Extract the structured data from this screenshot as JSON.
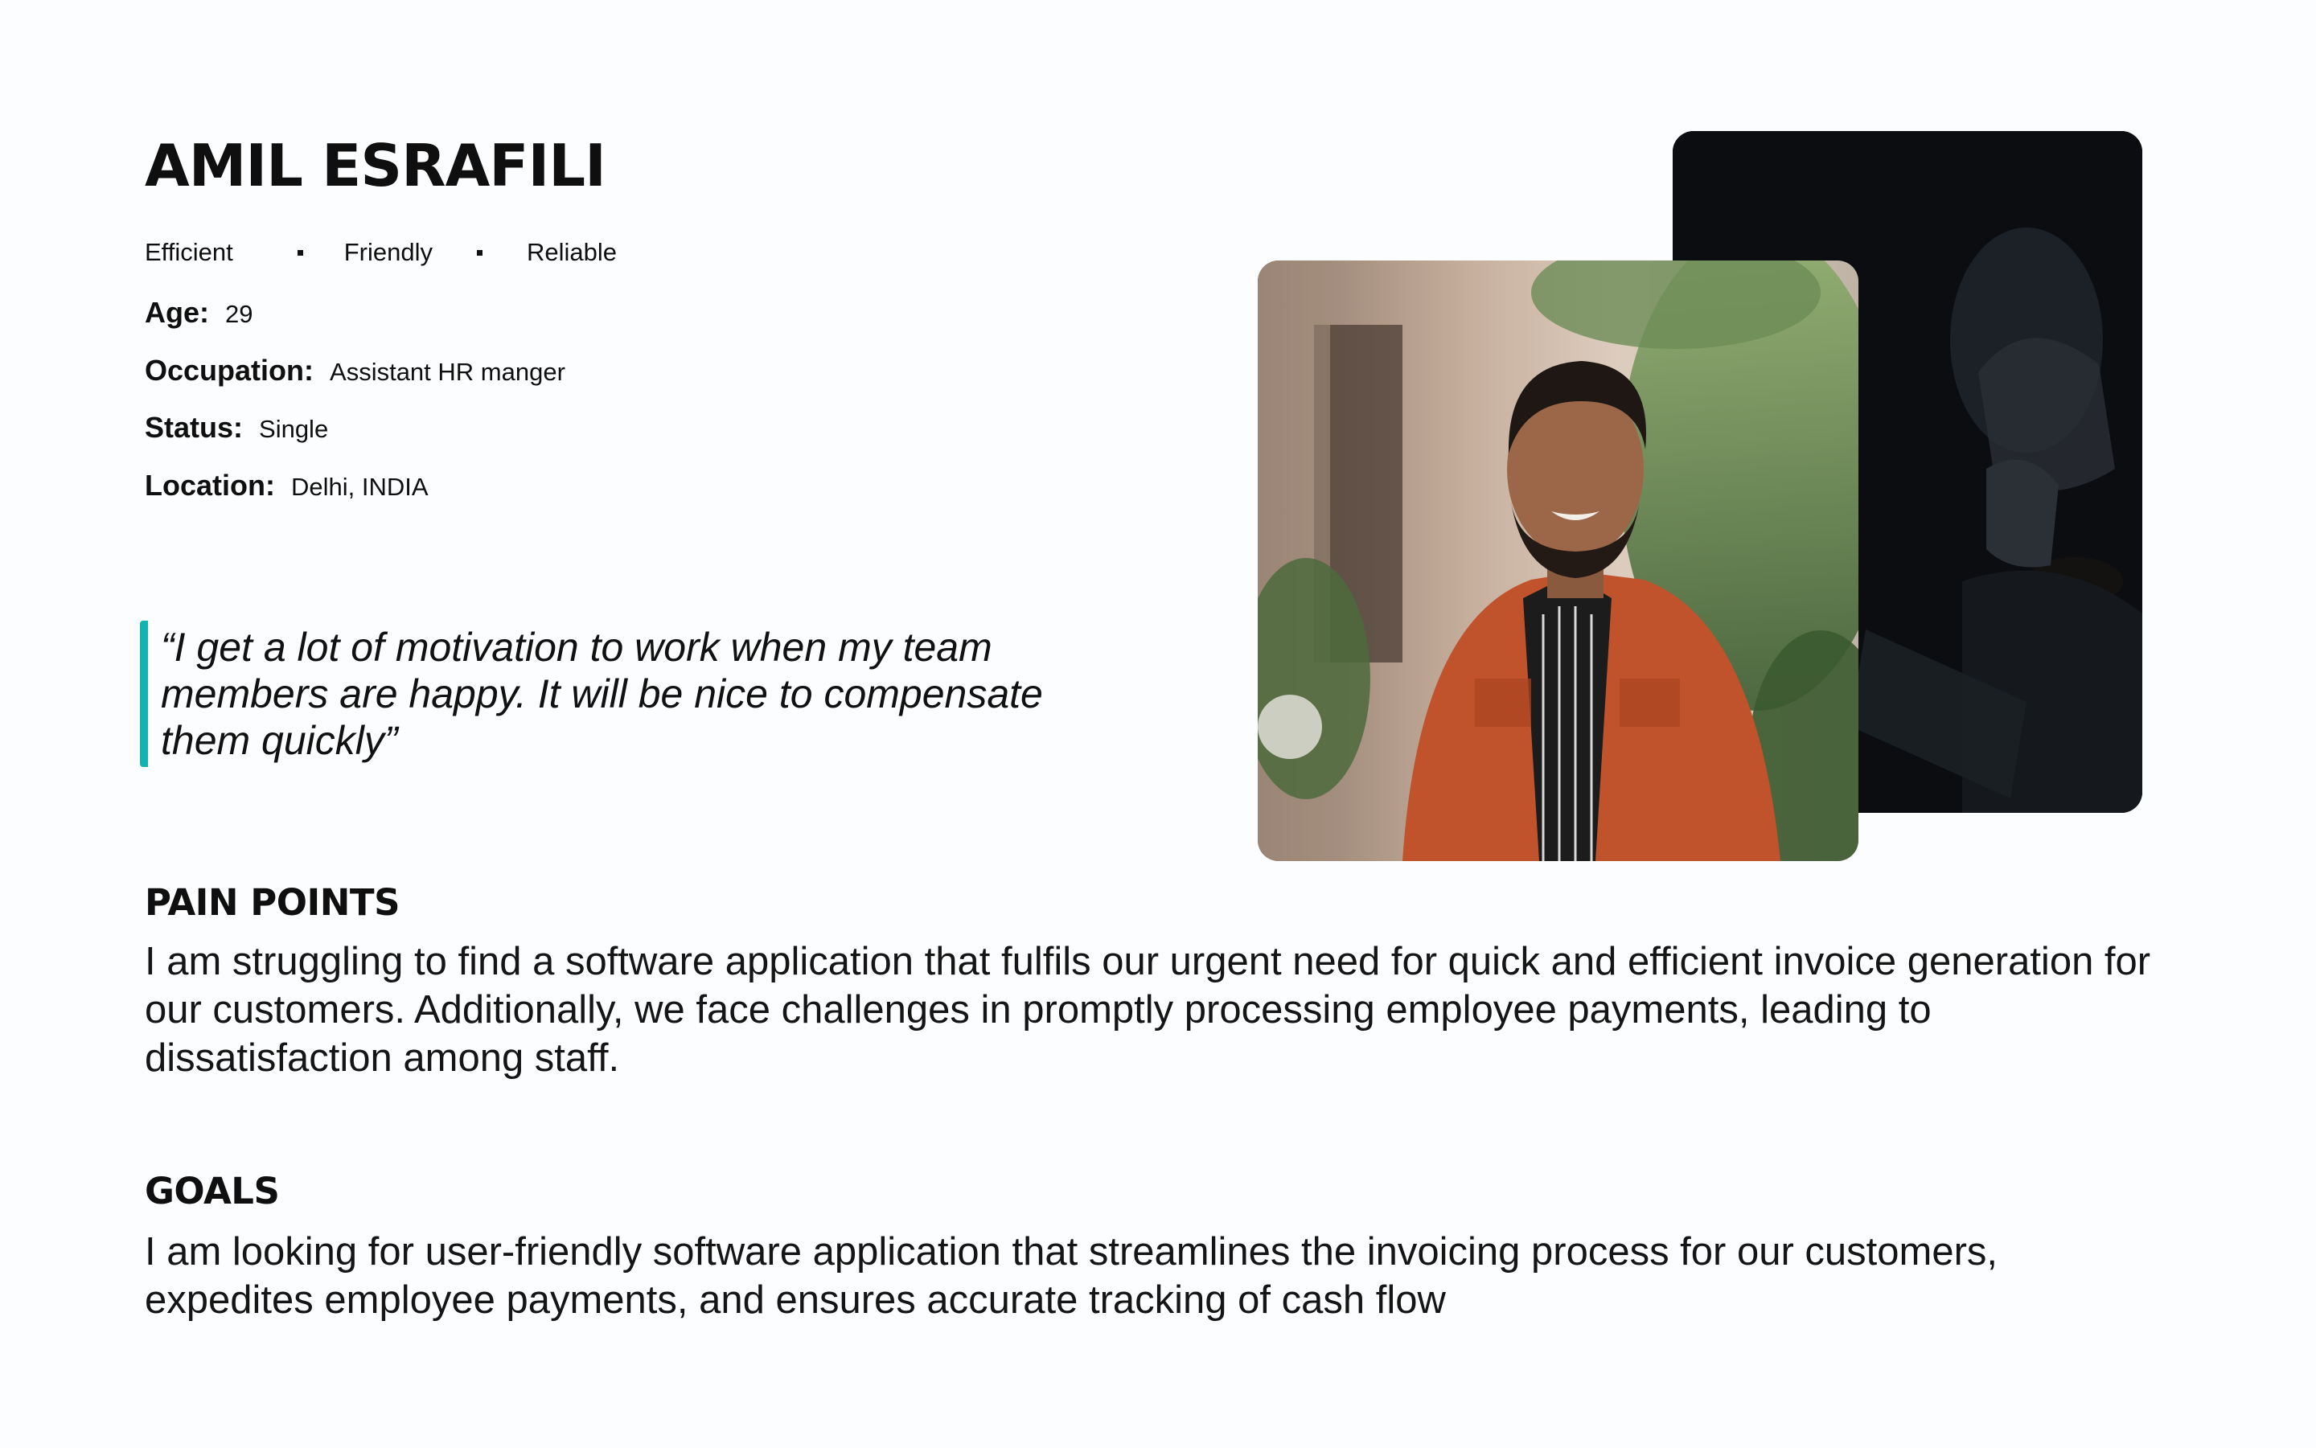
{
  "persona": {
    "name": "AMIL ESRAFILI",
    "traits": [
      "Efficient",
      "Friendly",
      "Reliable"
    ],
    "details": [
      {
        "label": "Age:",
        "value": "29"
      },
      {
        "label": "Occupation:",
        "value": "Assistant HR manger"
      },
      {
        "label": "Status:",
        "value": "Single"
      },
      {
        "label": "Location:",
        "value": "Delhi, INDIA"
      }
    ],
    "quote": "“I get a lot of motivation to work when my team members are happy. It will be nice to compensate them quickly”"
  },
  "pain_points": {
    "heading": "PAIN POINTS",
    "body": "I am struggling to find a software application that fulfils our urgent need for quick and efficient invoice generation for our customers. Additionally, we face challenges in promptly processing employee payments, leading to dissatisfaction among staff."
  },
  "goals": {
    "heading": "GOALS",
    "body": "I am looking for user-friendly software application that streamlines the invoicing process for our customers, expedites employee payments, and ensures accurate tracking of cash flow"
  },
  "colors": {
    "accent": "#13b3b0",
    "background": "#fcfdfe",
    "text": "#0f0f0f",
    "jacket": "#c0532c"
  }
}
